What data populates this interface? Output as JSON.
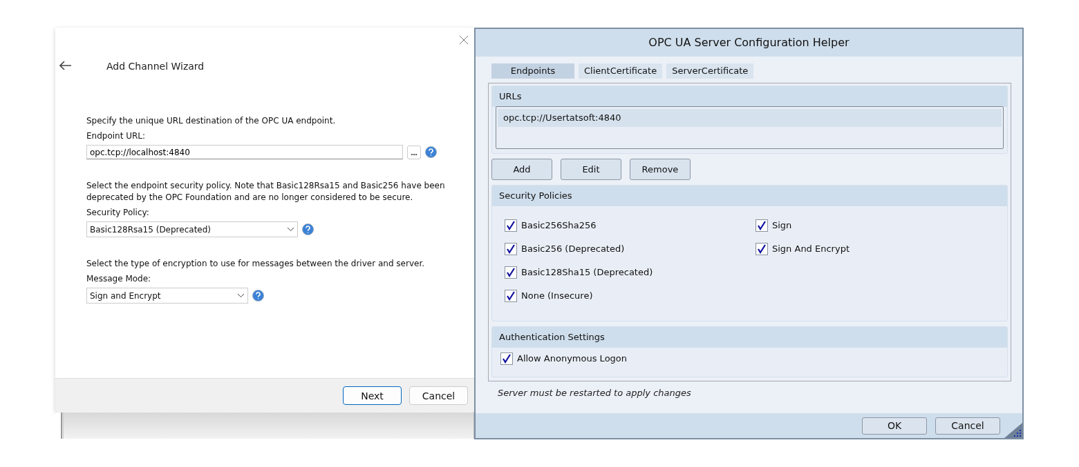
{
  "wizard": {
    "title": "Add Channel Wizard",
    "fields": [
      {
        "kind": "text",
        "description": "Specify the unique URL destination of the OPC UA endpoint.",
        "label": "Endpoint URL:",
        "value": "opc.tcp://localhost:4840",
        "browse": "..."
      },
      {
        "kind": "select",
        "description": "Select the endpoint security policy. Note that Basic128Rsa15 and Basic256 have been deprecated by the OPC Foundation and are no longer considered to be secure.",
        "label": "Security Policy:",
        "value": "Basic128Rsa15 (Deprecated)"
      },
      {
        "kind": "select",
        "description": "Select the type of encryption to use for messages between the driver and server.",
        "label": "Message Mode:",
        "value": "Sign and Encrypt"
      }
    ],
    "buttons": [
      {
        "label": "Next",
        "default": true
      },
      {
        "label": "Cancel",
        "default": false
      }
    ]
  },
  "helper": {
    "title": "OPC UA Server Configuration Helper",
    "tabs": [
      {
        "label": "Endpoints",
        "selected": true
      },
      {
        "label": "ClientCertificate",
        "selected": false
      },
      {
        "label": "ServerCertificate",
        "selected": false
      }
    ],
    "urls": {
      "heading": "URLs",
      "items": [
        {
          "text": "opc.tcp://Usertatsoft:4840",
          "selected": true
        }
      ]
    },
    "url_buttons": [
      "Add",
      "Edit",
      "Remove"
    ],
    "security": {
      "heading": "Security Policies",
      "policies": [
        {
          "label": "Basic256Sha256",
          "checked": true
        },
        {
          "label": "Basic256 (Deprecated)",
          "checked": true
        },
        {
          "label": "Basic128Sha15 (Deprecated)",
          "checked": true
        },
        {
          "label": "None (Insecure)",
          "checked": true
        }
      ],
      "modes": [
        {
          "label": "Sign",
          "checked": true
        },
        {
          "label": "Sign And Encrypt",
          "checked": true
        }
      ]
    },
    "auth": {
      "heading": "Authentication Settings",
      "options": [
        {
          "label": "Allow Anonymous Logon",
          "checked": true
        }
      ]
    },
    "note": "Server must be restarted to apply changes",
    "buttons": [
      "OK",
      "Cancel"
    ]
  }
}
